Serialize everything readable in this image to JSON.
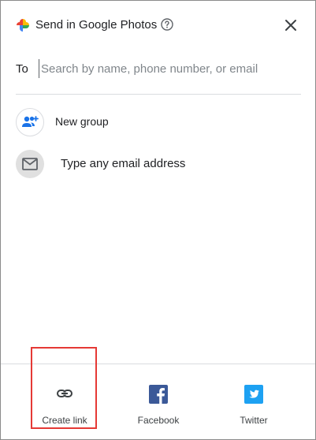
{
  "header": {
    "title": "Send in Google Photos",
    "logo_icon": "google-photos-pinwheel",
    "help_icon": "help-circle-icon",
    "close_icon": "close-x-icon"
  },
  "to_field": {
    "label": "To",
    "placeholder": "Search by name, phone number, or email"
  },
  "suggestions": [
    {
      "label": "New group",
      "icon": "add-people-icon"
    },
    {
      "label": "Type any email address",
      "icon": "mail-icon"
    }
  ],
  "share_options": [
    {
      "label": "Create link",
      "icon": "link-icon",
      "highlighted": true
    },
    {
      "label": "Facebook",
      "icon": "facebook-icon",
      "color": "#3b5998"
    },
    {
      "label": "Twitter",
      "icon": "twitter-icon",
      "color": "#1da1f2"
    }
  ],
  "colors": {
    "accent_blue": "#1a73e8",
    "highlight_red": "#e53935"
  }
}
